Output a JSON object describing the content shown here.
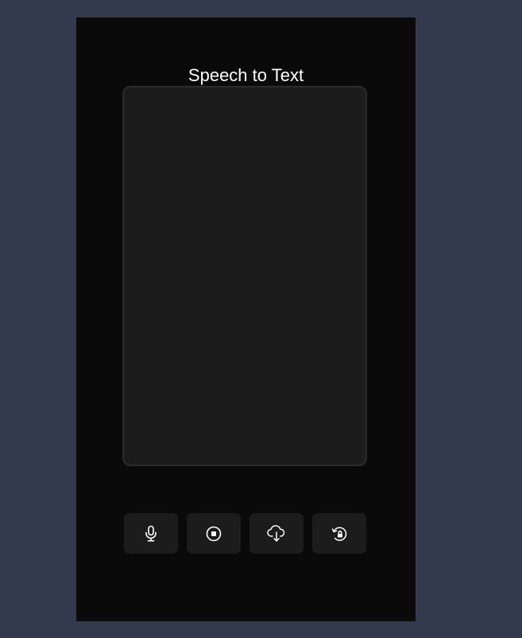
{
  "app": {
    "title": "Speech to Text"
  },
  "transcript": {
    "value": "",
    "placeholder": ""
  },
  "controls": [
    {
      "name": "start-recording",
      "icon": "microphone-icon"
    },
    {
      "name": "stop-recording",
      "icon": "stop-circle-icon"
    },
    {
      "name": "download",
      "icon": "cloud-download-icon"
    },
    {
      "name": "reset",
      "icon": "restore-lock-icon"
    }
  ],
  "colors": {
    "page_background": "#343a4d",
    "panel_background": "#0a0a0b",
    "surface": "#1c1c1c",
    "border": "#2b2b2b",
    "icon": "#ffffff",
    "text": "#ffffff"
  }
}
